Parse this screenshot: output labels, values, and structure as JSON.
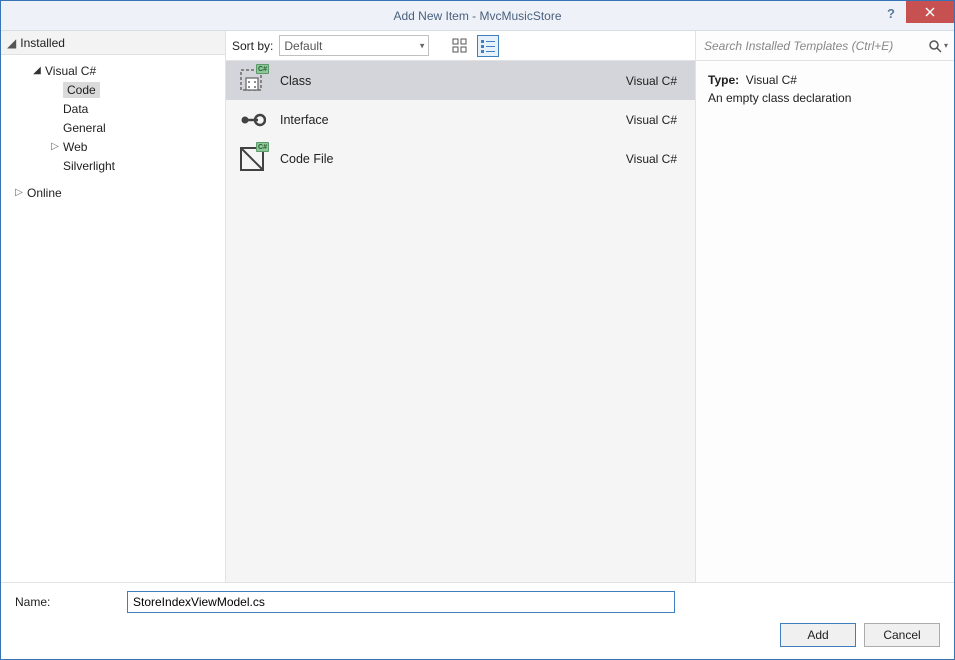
{
  "title": "Add New Item - MvcMusicStore",
  "tree": {
    "header": "Installed",
    "visual_csharp": "Visual C#",
    "code": "Code",
    "data": "Data",
    "general": "General",
    "web": "Web",
    "silverlight": "Silverlight",
    "online": "Online"
  },
  "toolbar": {
    "sort_label": "Sort by:",
    "sort_value": "Default"
  },
  "templates": [
    {
      "name": "Class",
      "lang": "Visual C#"
    },
    {
      "name": "Interface",
      "lang": "Visual C#"
    },
    {
      "name": "Code File",
      "lang": "Visual C#"
    }
  ],
  "search": {
    "placeholder": "Search Installed Templates (Ctrl+E)"
  },
  "description": {
    "type_label": "Type:",
    "type_value": "Visual C#",
    "text": "An empty class declaration"
  },
  "name_field": {
    "label": "Name:",
    "value": "StoreIndexViewModel.cs"
  },
  "buttons": {
    "add": "Add",
    "cancel": "Cancel"
  }
}
